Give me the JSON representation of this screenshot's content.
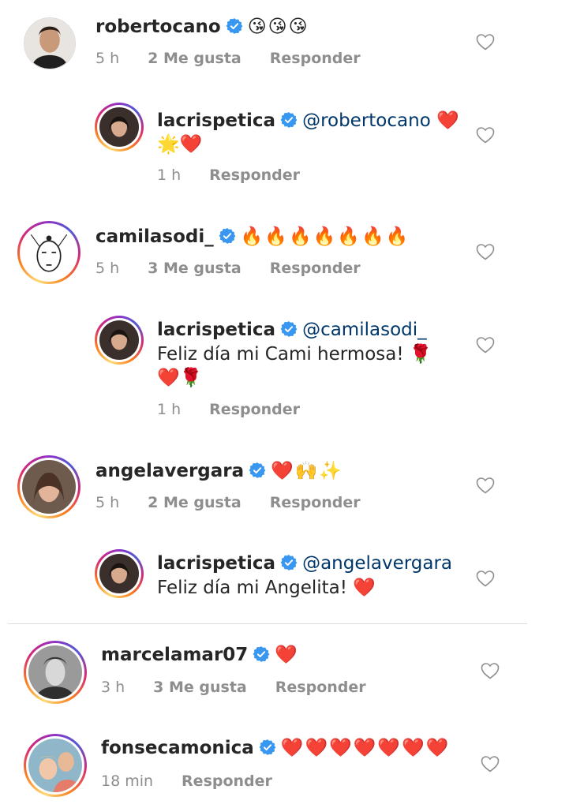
{
  "comments": [
    {
      "username": "robertocano",
      "text": "😘😘😘",
      "time": "5 h",
      "likes": "2 Me gusta",
      "reply": "Responder"
    },
    {
      "username": "lacrispetica",
      "mention": "@robertocano",
      "text": "❤️",
      "cont": "🌟❤️",
      "time": "1 h",
      "reply": "Responder"
    },
    {
      "username": "camilasodi_",
      "text": "🔥🔥🔥🔥🔥🔥🔥",
      "time": "5 h",
      "likes": "3 Me gusta",
      "reply": "Responder"
    },
    {
      "username": "lacrispetica",
      "mention": "@camilasodi_",
      "cont": "Feliz día mi Cami hermosa! 🌹",
      "cont2": "❤️🌹",
      "time": "1 h",
      "reply": "Responder"
    },
    {
      "username": "angelavergara",
      "text": "❤️🙌✨",
      "time": "5 h",
      "likes": "2 Me gusta",
      "reply": "Responder"
    },
    {
      "username": "lacrispetica",
      "mention": "@angelavergara",
      "cont": "Feliz día mi Angelita! ❤️"
    },
    {
      "username": "marcelamar07",
      "text": "❤️",
      "time": "3 h",
      "likes": "3 Me gusta",
      "reply": "Responder"
    },
    {
      "username": "fonsecamonica",
      "text": "❤️❤️❤️❤️❤️❤️❤️",
      "time": "18 min",
      "reply": "Responder"
    }
  ],
  "icons": {
    "verified": "verified-badge-icon",
    "like": "heart-outline-icon"
  },
  "colors": {
    "verified": "#3897f0",
    "mention": "#00376b",
    "meta": "#8e8e8e"
  }
}
